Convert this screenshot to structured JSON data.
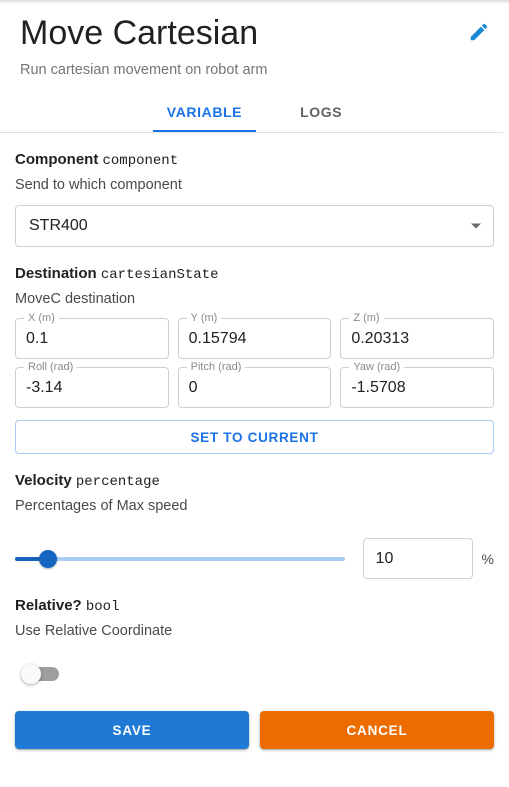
{
  "header": {
    "title": "Move Cartesian",
    "subtitle": "Run cartesian movement on robot arm",
    "edit_icon": "pencil-edit-icon",
    "accent_color": "#1a73e8"
  },
  "tabs": [
    {
      "label": "VARIABLE",
      "active": true
    },
    {
      "label": "LOGS",
      "active": false
    }
  ],
  "component_section": {
    "title": "Component",
    "mono": "component",
    "description": "Send to which component",
    "select": {
      "value": "STR400",
      "arrow_icon": "chevron-down-icon"
    }
  },
  "destination_section": {
    "title": "Destination",
    "mono": "cartesianState",
    "description": "MoveC destination",
    "fields": [
      {
        "label": "X (m)",
        "value": "0.1",
        "name": "x"
      },
      {
        "label": "Y (m)",
        "value": "0.15794",
        "name": "y"
      },
      {
        "label": "Z (m)",
        "value": "0.20313",
        "name": "z"
      },
      {
        "label": "Roll (rad)",
        "value": "-3.14",
        "name": "roll"
      },
      {
        "label": "Pitch (rad)",
        "value": "0",
        "name": "pitch"
      },
      {
        "label": "Yaw (rad)",
        "value": "-1.5708",
        "name": "yaw"
      }
    ],
    "set_to_current_label": "SET TO CURRENT"
  },
  "velocity_section": {
    "title": "Velocity",
    "mono": "percentage",
    "description": "Percentages of Max speed",
    "slider": {
      "value": 10,
      "min": 0,
      "max": 100,
      "fill_color": "#1565c0",
      "track_color": "#a7cdf2"
    },
    "input_value": "10",
    "unit": "%"
  },
  "relative_section": {
    "title": "Relative?",
    "mono": "bool",
    "description": "Use Relative Coordinate",
    "toggle": {
      "checked": false,
      "state_label": "off"
    }
  },
  "footer": {
    "save_label": "SAVE",
    "cancel_label": "CANCEL",
    "save_color": "#1e7ad4",
    "cancel_color": "#ec6c00"
  }
}
